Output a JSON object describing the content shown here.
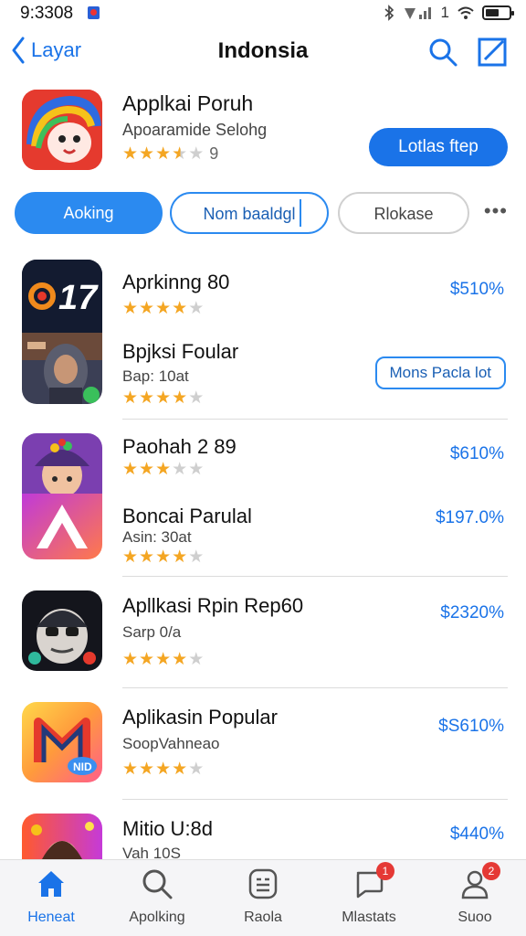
{
  "status": {
    "time": "9:3308",
    "signal_text": "1"
  },
  "nav": {
    "back_label": "Layar",
    "title": "Indonsia"
  },
  "featured": {
    "title": "Applkai Poruh",
    "subtitle": "Apoaramide Selohg",
    "rating": 3.5,
    "rating_text": "9",
    "button_label": "Lotlas ftep"
  },
  "filters": [
    {
      "label": "Aoking"
    },
    {
      "label": "Nom baaldgl"
    },
    {
      "label": "Rlokase"
    }
  ],
  "apps": [
    {
      "title": "Aprkinng 80",
      "price": "$510%",
      "stars": 4
    },
    {
      "title": "Bpjksi Foular",
      "subtitle": "Bap: 10at",
      "stars": 4,
      "button_label": "Mons Pacla lot"
    },
    {
      "title": "Paohah 2 89",
      "price": "$610%",
      "stars": 3
    },
    {
      "title": "Boncai Parulal",
      "subtitle": "Asin: 30at",
      "price": "$197.0%",
      "stars": 4
    },
    {
      "title": "Apllkasi Rpin Rep60",
      "subtitle": "Sarp 0/a",
      "price": "$2320%",
      "stars": 4
    },
    {
      "title": "Aplikasin Popular",
      "subtitle": "SoopVahneao",
      "price": "$S610%",
      "stars": 4
    },
    {
      "title": "Mitio U:8d",
      "subtitle": "Vah 10S",
      "price": "$440%"
    }
  ],
  "tabs": [
    {
      "label": "Heneat",
      "icon": "home-icon",
      "active": true
    },
    {
      "label": "Apolking",
      "icon": "search-icon"
    },
    {
      "label": "Raola",
      "icon": "apps-grid-icon"
    },
    {
      "label": "Mlastats",
      "icon": "chat-icon",
      "badge": "1"
    },
    {
      "label": "Suoo",
      "icon": "profile-icon",
      "badge": "2"
    }
  ],
  "colors": {
    "accent": "#1a73e8",
    "star": "#f4a623",
    "badge": "#e53935"
  }
}
